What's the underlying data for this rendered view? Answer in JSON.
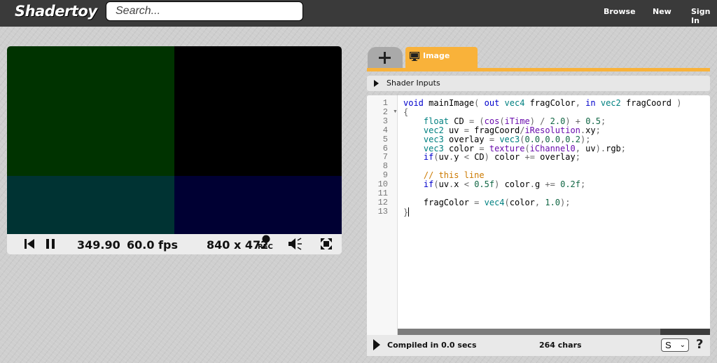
{
  "header": {
    "logo": "Shadertoy",
    "search_placeholder": "Search...",
    "nav": [
      "Browse",
      "New",
      "Sign In"
    ]
  },
  "player": {
    "time": "349.90",
    "fps": "60.0 fps",
    "resolution": "840 x 472",
    "rec_label": "REC",
    "colors": {
      "top_left": "#003300",
      "top_right": "#000000",
      "bottom_left": "#003333",
      "bottom_right": "#000033"
    },
    "icons": [
      "rewind-icon",
      "pause-icon",
      "record-icon",
      "volume-icon",
      "fullscreen-icon"
    ]
  },
  "editor": {
    "add_tab_icon": "plus-icon",
    "tab_label": "Image",
    "tab_icon": "monitor-icon",
    "shader_inputs_label": "Shader Inputs",
    "line_numbers": [
      "1",
      "2",
      "3",
      "4",
      "5",
      "6",
      "7",
      "8",
      "9",
      "10",
      "11",
      "12",
      "13"
    ],
    "code_lines": [
      "void mainImage( out vec4 fragColor, in vec2 fragCoord )",
      "{",
      "    float CD = (cos(iTime) / 2.0) + 0.5;",
      "    vec2 uv = fragCoord/iResolution.xy;",
      "    vec3 overlay = vec3(0.0,0.0,0.2);",
      "    vec3 color = texture(iChannel0, uv).rgb;",
      "    if(uv.y < CD) color += overlay;",
      "",
      "    // this line",
      "    if(uv.x < 0.5f) color.g += 0.2f;",
      "",
      "    fragColor = vec4(color, 1.0);",
      "}"
    ],
    "status": {
      "compiled": "Compiled in 0.0 secs",
      "chars": "264 chars",
      "select_value": "S",
      "help": "?"
    },
    "accent_color": "#f9b23a"
  }
}
